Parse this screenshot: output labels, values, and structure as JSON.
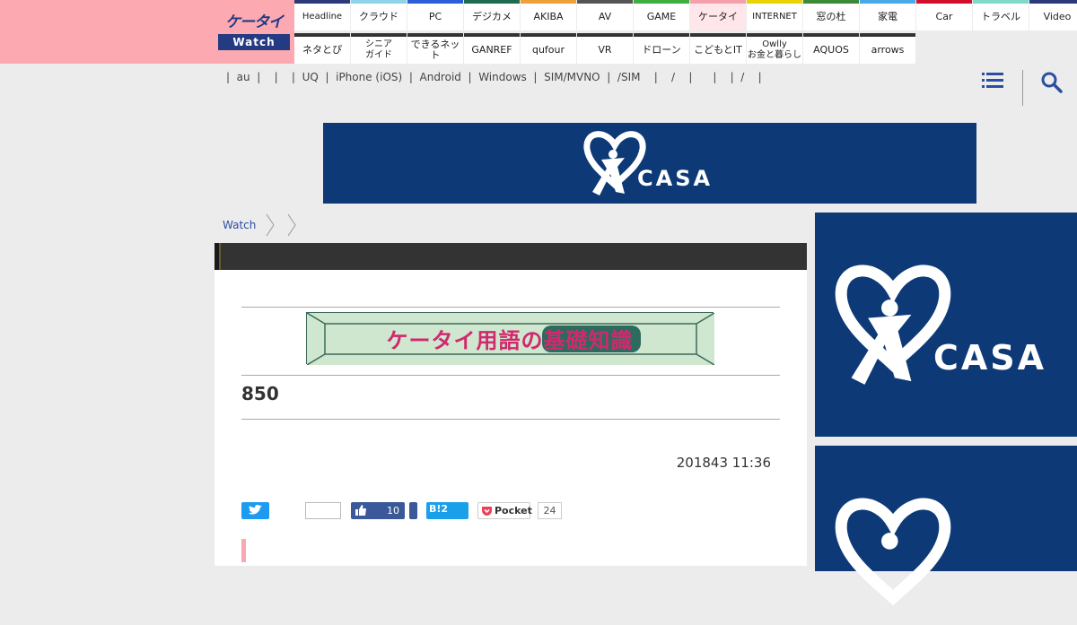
{
  "logo": {
    "top": "ケータイ",
    "bottom": "Watch"
  },
  "nav_row1": [
    {
      "label": "Headline",
      "color": "#2c3a7c"
    },
    {
      "label": "クラウド",
      "color": "#8fd3e8"
    },
    {
      "label": "PC",
      "color": "#2c5ed8"
    },
    {
      "label": "デジカメ",
      "color": "#1f6b4f"
    },
    {
      "label": "AKIBA",
      "color": "#f0a03a"
    },
    {
      "label": "AV",
      "color": "#555555"
    },
    {
      "label": "GAME",
      "color": "#3fae3f"
    },
    {
      "label": "ケータイ",
      "color": "#f4a0ab",
      "active": true
    },
    {
      "label": "INTERNET",
      "color": "#e8d400"
    },
    {
      "label": "窓の杜",
      "color": "#3a8a3a"
    },
    {
      "label": "家電",
      "color": "#4aa8e8"
    },
    {
      "label": "Car",
      "color": "#d0102a"
    },
    {
      "label": "トラベル",
      "color": "#7fd8c8"
    },
    {
      "label": "Video",
      "color": "#2c3a7c"
    }
  ],
  "nav_row2": [
    {
      "label": "ネタとぴ",
      "color": "#333333"
    },
    {
      "label": "シニア\nガイド",
      "color": "#333333"
    },
    {
      "label": "できるネット",
      "color": "#333333"
    },
    {
      "label": "GANREF",
      "color": "#333333"
    },
    {
      "label": "qufour",
      "color": "#333333"
    },
    {
      "label": "VR",
      "color": "#333333"
    },
    {
      "label": "ドローン",
      "color": "#333333"
    },
    {
      "label": "こどもとIT",
      "color": "#333333"
    },
    {
      "label": "Owlly\nお金と暮らし",
      "color": "#333333"
    },
    {
      "label": "AQUOS",
      "color": "#333333"
    },
    {
      "label": "arrows",
      "color": "#333333"
    }
  ],
  "subnav": [
    "|",
    "  au  ",
    "|",
    "    ",
    "|",
    "    ",
    "|",
    "  UQ  ",
    "|",
    "  iPhone (iOS)  ",
    "|",
    "  Android  ",
    "|",
    "  Windows  ",
    "|",
    "  SIM/MVNO  ",
    "|",
    "  /SIM  ",
    "  |  ",
    "  /  ",
    "  |  ",
    "    ",
    "|",
    "    ",
    "|",
    "  /  ",
    "  |  "
  ],
  "banner": {
    "brand": "CASA",
    "reg": "®"
  },
  "breadcrumb": {
    "home": "Watch"
  },
  "article": {
    "topic_banner": "ケータイ用語の基礎知識",
    "title": "850",
    "date": "201843 11:36"
  },
  "share": {
    "like_count": "10",
    "hatena": "B!2",
    "pocket_label": "Pocket",
    "pocket_count": "24"
  },
  "colors": {
    "header_pink": "#fda9b2",
    "banner_navy": "#0d3a77"
  }
}
